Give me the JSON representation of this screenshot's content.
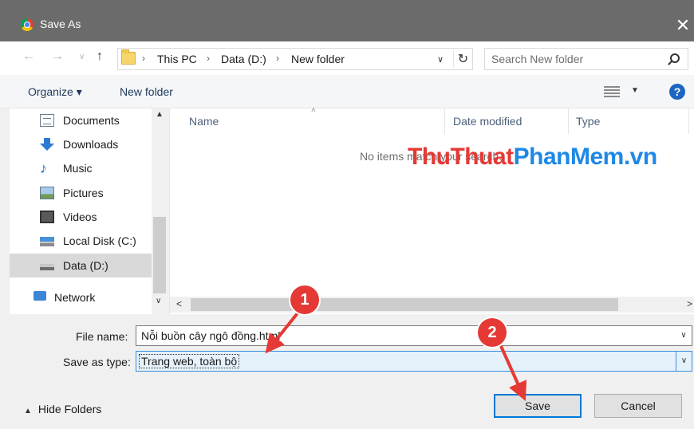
{
  "window": {
    "title": "Save As",
    "close_glyph": "✕"
  },
  "address": {
    "back_glyph": "←",
    "forward_glyph": "→",
    "recent_glyph": "∨",
    "up_glyph": "↑",
    "sep_glyph": "›",
    "crumbs": [
      "This PC",
      "Data (D:)",
      "New folder"
    ],
    "dropdown_glyph": "∨",
    "refresh_glyph": "↻"
  },
  "search": {
    "placeholder": "Search New folder"
  },
  "toolbar": {
    "organize_label": "Organize ▾",
    "newfolder_label": "New folder",
    "view_drop_glyph": "▼",
    "help_glyph": "?"
  },
  "nav": {
    "items": [
      {
        "label": "Documents",
        "icon": "documents-icon"
      },
      {
        "label": "Downloads",
        "icon": "downloads-icon"
      },
      {
        "label": "Music",
        "icon": "music-icon"
      },
      {
        "label": "Pictures",
        "icon": "pictures-icon"
      },
      {
        "label": "Videos",
        "icon": "videos-icon"
      },
      {
        "label": "Local Disk (C:)",
        "icon": "local-disk-icon"
      },
      {
        "label": "Data (D:)",
        "icon": "data-drive-icon",
        "selected": true
      },
      {
        "label": "Network",
        "icon": "network-icon"
      }
    ],
    "scroll_up_glyph": "▲",
    "scroll_down_glyph": "∨",
    "music_glyph": "♪"
  },
  "files": {
    "columns": [
      "Name",
      "Date modified",
      "Type"
    ],
    "sort_glyph": "˄",
    "empty_message": "No items match your search.",
    "scroll_left_glyph": "<",
    "scroll_right_glyph": ">"
  },
  "watermark": {
    "part1": "ThuThuat",
    "part2": "PhanMem.vn"
  },
  "form": {
    "filename_label": "File name:",
    "filename_value": "Nỗi buồn cây ngô đồng.html",
    "savetype_label": "Save as type:",
    "savetype_value": "Trang web, toàn bộ",
    "dropdown_glyph": "∨"
  },
  "footer": {
    "hide_folders_caret": "▲",
    "hide_folders_label": "Hide Folders",
    "save_label": "Save",
    "cancel_label": "Cancel"
  },
  "annotations": {
    "marker1": "1",
    "marker2": "2",
    "color": "#e53935"
  }
}
